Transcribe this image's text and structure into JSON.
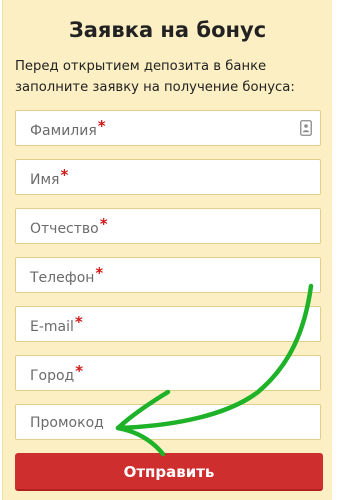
{
  "form": {
    "title": "Заявка на бонус",
    "intro": "Перед открытием депозита в банке заполните заявку на получение бонуса:",
    "fields": [
      {
        "placeholder": "Фамилия",
        "required": true,
        "icon": "contact-card-icon"
      },
      {
        "placeholder": "Имя",
        "required": true
      },
      {
        "placeholder": "Отчество",
        "required": true
      },
      {
        "placeholder": "Телефон",
        "required": true
      },
      {
        "placeholder": "E-mail",
        "required": true
      },
      {
        "placeholder": "Город",
        "required": true
      },
      {
        "placeholder": "Промокод",
        "required": false
      }
    ],
    "required_mark": "*",
    "submit_label": "Отправить"
  },
  "annotation": {
    "type": "hand-drawn-arrow",
    "color": "#1db227",
    "points_to": "Промокод"
  },
  "colors": {
    "panel_bg": "#fbefc3",
    "field_border": "#e0cf8a",
    "required_mark": "#d01818",
    "submit_bg": "#cf2e2e"
  }
}
